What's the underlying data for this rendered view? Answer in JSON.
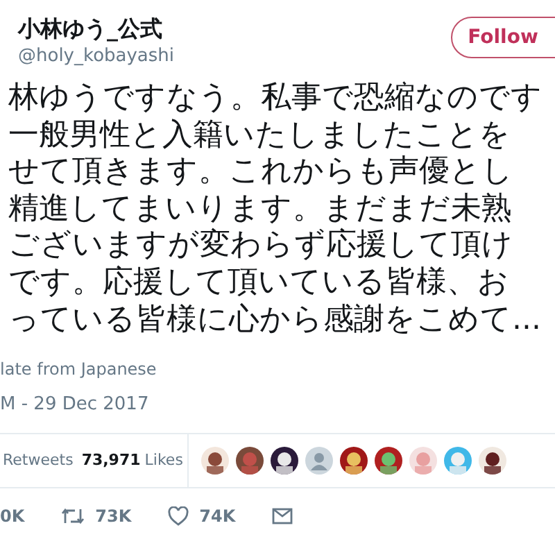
{
  "author": {
    "name": "小林ゆう_公式",
    "handle": "@holy_kobayashi"
  },
  "follow_button": "Follow",
  "tweet_lines": [
    "林ゆうですなう。私事で恐縮なのです",
    "一般男性と入籍いたしましたことを",
    "せて頂きます。これからも声優とし",
    "精進してまいります。まだまだ未熟",
    "ございますが変わらず応援して頂け",
    "です。応援して頂いている皆様、お",
    "っている皆様に心から感謝をこめて..."
  ],
  "translate_link": "late from Japanese",
  "timestamp": "M - 29 Dec 2017",
  "stats": {
    "retweets_label": "Retweets",
    "likes_count": "73,971",
    "likes_label": "Likes"
  },
  "liker_avatars": [
    {
      "kind": "picture"
    },
    {
      "kind": "picture"
    },
    {
      "kind": "picture"
    },
    {
      "kind": "default"
    },
    {
      "kind": "picture"
    },
    {
      "kind": "picture"
    },
    {
      "kind": "picture"
    },
    {
      "kind": "picture"
    },
    {
      "kind": "picture"
    }
  ],
  "actions": [
    {
      "kind": "reply",
      "count": "0K"
    },
    {
      "kind": "retweet",
      "count": "73K"
    },
    {
      "kind": "like",
      "count": "74K"
    },
    {
      "kind": "message"
    }
  ]
}
